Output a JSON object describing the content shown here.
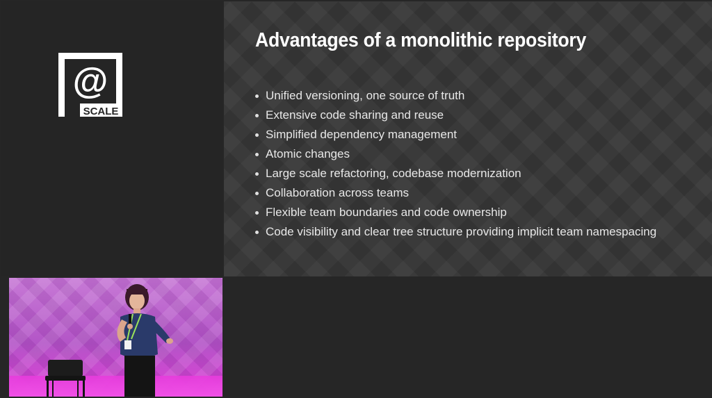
{
  "branding": {
    "logo_symbol": "@",
    "logo_text": "SCALE"
  },
  "slide": {
    "title": "Advantages of a monolithic repository",
    "bullets": [
      "Unified versioning, one source of truth",
      "Extensive code sharing and reuse",
      "Simplified dependency management",
      "Atomic changes",
      "Large scale refactoring, codebase modernization",
      "Collaboration across teams",
      "Flexible team boundaries and code ownership",
      "Code visibility and clear tree structure providing implicit team namespacing"
    ]
  },
  "video": {
    "description_icon": "speaker-video-feed"
  },
  "colors": {
    "background": "#262626",
    "slide_background": "#333333",
    "text": "#ffffff",
    "stage": "#b25ac8"
  }
}
